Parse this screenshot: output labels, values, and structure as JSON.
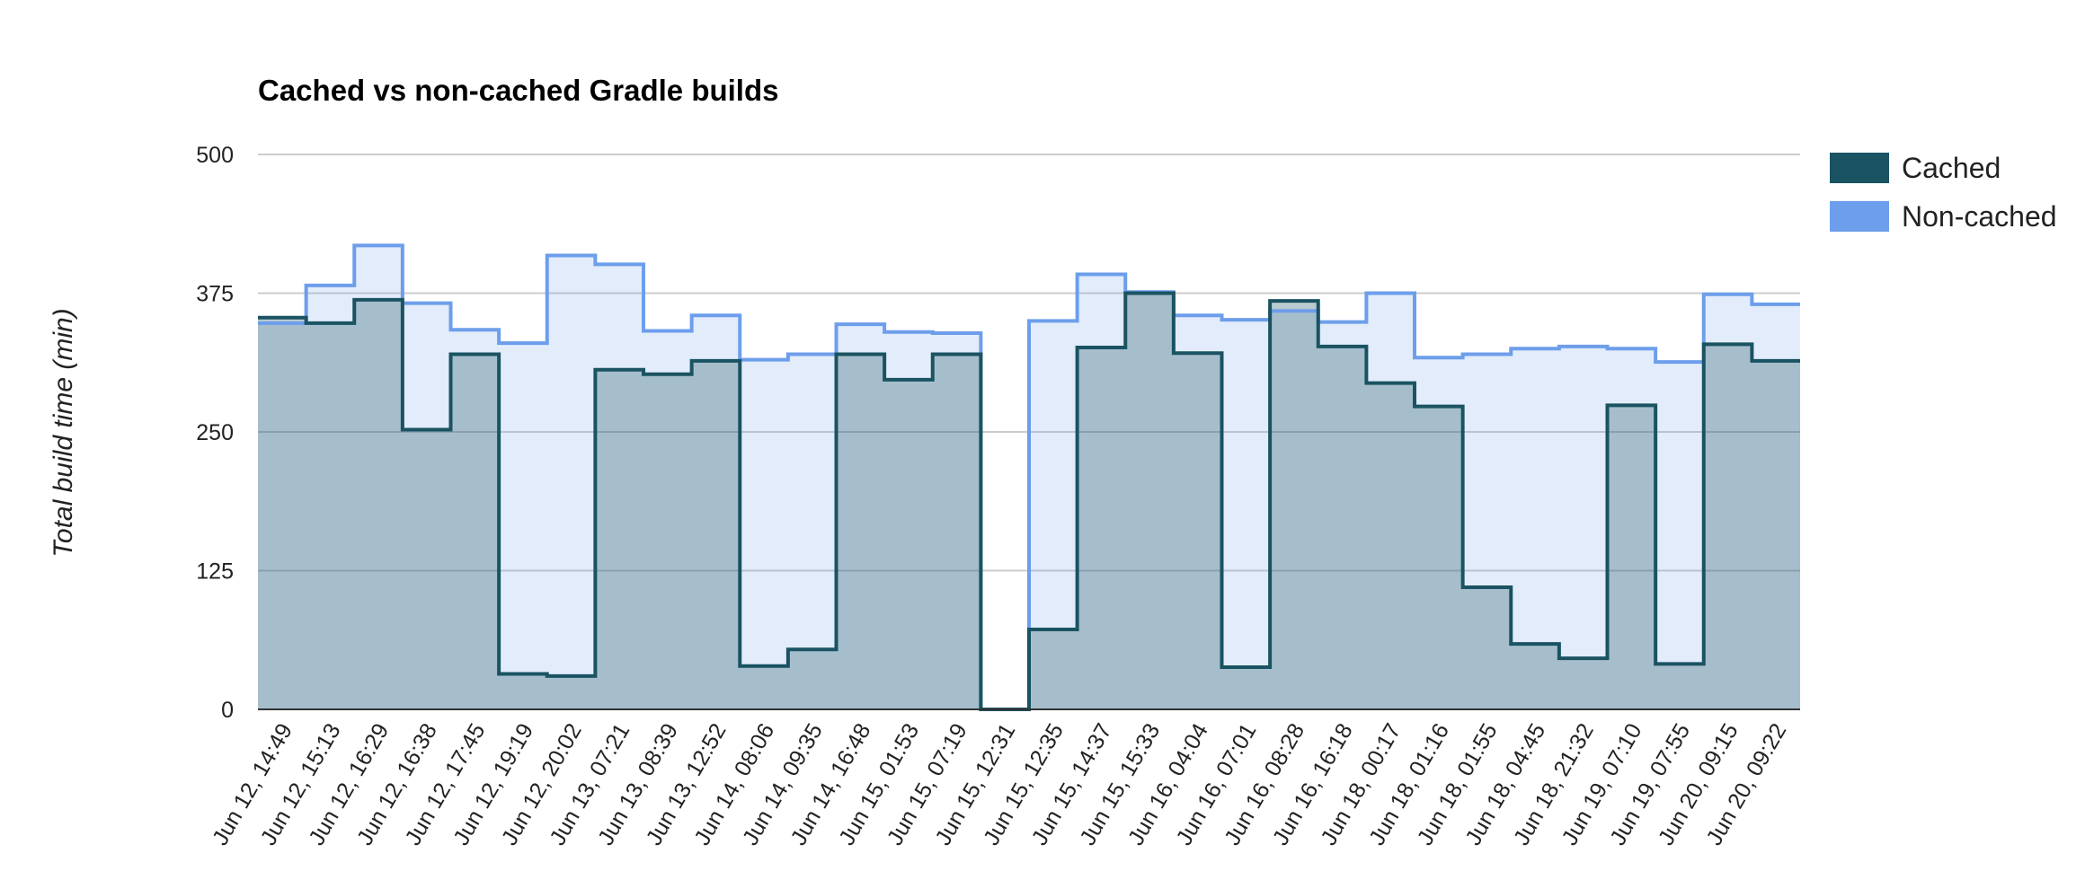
{
  "chart_data": {
    "type": "area",
    "title": "Cached vs non-cached Gradle builds",
    "xlabel": "",
    "ylabel": "Total build time (min)",
    "ylim": [
      0,
      500
    ],
    "yticks": [
      0,
      125,
      250,
      375,
      500
    ],
    "grid": true,
    "legend_position": "right",
    "categories": [
      "Jun 12, 14:49",
      "Jun 12, 15:13",
      "Jun 12, 16:29",
      "Jun 12, 16:38",
      "Jun 12, 17:45",
      "Jun 12, 19:19",
      "Jun 12, 20:02",
      "Jun 13, 07:21",
      "Jun 13, 08:39",
      "Jun 13, 12:52",
      "Jun 14, 08:06",
      "Jun 14, 09:35",
      "Jun 14, 16:48",
      "Jun 15, 01:53",
      "Jun 15, 07:19",
      "Jun 15, 12:31",
      "Jun 15, 12:35",
      "Jun 15, 14:37",
      "Jun 15, 15:33",
      "Jun 16, 04:04",
      "Jun 16, 07:01",
      "Jun 16, 08:28",
      "Jun 16, 16:18",
      "Jun 18, 00:17",
      "Jun 18, 01:16",
      "Jun 18, 01:55",
      "Jun 18, 04:45",
      "Jun 18, 21:32",
      "Jun 19, 07:10",
      "Jun 19, 07:55",
      "Jun 20, 09:15",
      "Jun 20, 09:22"
    ],
    "series": [
      {
        "name": "Cached",
        "color": "#1a5361",
        "values": [
          353,
          348,
          369,
          252,
          320,
          32,
          30,
          306,
          302,
          314,
          39,
          54,
          320,
          297,
          320,
          0,
          72,
          326,
          375,
          321,
          38,
          368,
          327,
          294,
          273,
          110,
          59,
          46,
          274,
          41,
          329,
          314
        ]
      },
      {
        "name": "Non-cached",
        "color": "#6d9eeb",
        "values": [
          348,
          382,
          418,
          366,
          342,
          330,
          409,
          401,
          341,
          355,
          315,
          320,
          347,
          340,
          339,
          0,
          350,
          392,
          376,
          355,
          351,
          359,
          349,
          375,
          317,
          320,
          325,
          327,
          325,
          313,
          374,
          365
        ]
      }
    ]
  }
}
